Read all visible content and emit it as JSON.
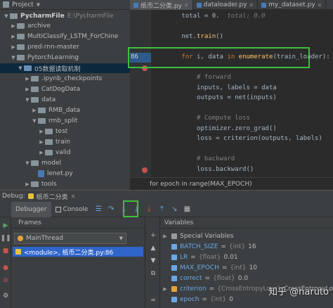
{
  "project": {
    "header_label": "Project",
    "root_name": "PycharmFile",
    "root_path": "E:\\PycharmFile",
    "tree": [
      {
        "label": "archive",
        "indent": 1,
        "open": false,
        "kind": "folder"
      },
      {
        "label": "MultiClassify_LSTM_ForChine",
        "indent": 1,
        "open": false,
        "kind": "folder"
      },
      {
        "label": "pred-rnn-master",
        "indent": 1,
        "open": false,
        "kind": "folder"
      },
      {
        "label": "PytorchLearning",
        "indent": 1,
        "open": true,
        "kind": "folder"
      },
      {
        "label": "05数据读取机制",
        "indent": 2,
        "open": true,
        "kind": "folder-blue",
        "selected": true
      },
      {
        "label": ".ipynb_checkpoints",
        "indent": 3,
        "open": false,
        "kind": "folder"
      },
      {
        "label": "CatDogData",
        "indent": 3,
        "open": false,
        "kind": "folder"
      },
      {
        "label": "data",
        "indent": 3,
        "open": true,
        "kind": "folder"
      },
      {
        "label": "RMB_data",
        "indent": 4,
        "open": false,
        "kind": "folder"
      },
      {
        "label": "rmb_split",
        "indent": 4,
        "open": true,
        "kind": "folder"
      },
      {
        "label": "test",
        "indent": 5,
        "open": false,
        "kind": "folder"
      },
      {
        "label": "train",
        "indent": 5,
        "open": false,
        "kind": "folder"
      },
      {
        "label": "valid",
        "indent": 5,
        "open": false,
        "kind": "folder"
      },
      {
        "label": "model",
        "indent": 3,
        "open": true,
        "kind": "folder"
      },
      {
        "label": "lenet.py",
        "indent": 4,
        "open": null,
        "kind": "py"
      },
      {
        "label": "tools",
        "indent": 3,
        "open": false,
        "kind": "folder"
      }
    ]
  },
  "tabs": [
    {
      "label": "纸币二分类.py",
      "active": true
    },
    {
      "label": "dataloader.py",
      "active": false
    },
    {
      "label": "my_dataset.py",
      "active": false
    }
  ],
  "editor": {
    "exec_line_number": "86",
    "breakpoints_at_rows": [
      5,
      15
    ],
    "lines": [
      {
        "tokens": [
          {
            "t": "        total = 0.  ",
            "c": ""
          },
          {
            "t": "total: 0.0",
            "c": "hint"
          }
        ]
      },
      {
        "tokens": [
          {
            "t": "",
            "c": ""
          }
        ]
      },
      {
        "tokens": [
          {
            "t": "        net.",
            "c": ""
          },
          {
            "t": "train",
            "c": "fn"
          },
          {
            "t": "()",
            "c": ""
          }
        ]
      },
      {
        "tokens": [
          {
            "t": "",
            "c": ""
          }
        ]
      },
      {
        "tokens": [
          {
            "t": "        ",
            "c": ""
          },
          {
            "t": "for",
            "c": "kw"
          },
          {
            "t": " i, data ",
            "c": ""
          },
          {
            "t": "in",
            "c": "kw"
          },
          {
            "t": " ",
            "c": ""
          },
          {
            "t": "enumerate",
            "c": "fn"
          },
          {
            "t": "(train_loader):",
            "c": ""
          }
        ]
      },
      {
        "tokens": [
          {
            "t": "",
            "c": ""
          }
        ]
      },
      {
        "tokens": [
          {
            "t": "            ",
            "c": ""
          },
          {
            "t": "# forward",
            "c": "cmt"
          }
        ]
      },
      {
        "tokens": [
          {
            "t": "            inputs, labels = data",
            "c": ""
          }
        ]
      },
      {
        "tokens": [
          {
            "t": "            outputs = net(inputs)",
            "c": ""
          }
        ]
      },
      {
        "tokens": [
          {
            "t": "",
            "c": ""
          }
        ]
      },
      {
        "tokens": [
          {
            "t": "            ",
            "c": ""
          },
          {
            "t": "# Compute loss",
            "c": "cmt"
          }
        ]
      },
      {
        "tokens": [
          {
            "t": "            optimizer.zero_grad()",
            "c": ""
          }
        ]
      },
      {
        "tokens": [
          {
            "t": "            loss = criterion(outputs, labels)",
            "c": ""
          }
        ]
      },
      {
        "tokens": [
          {
            "t": "",
            "c": ""
          }
        ]
      },
      {
        "tokens": [
          {
            "t": "            ",
            "c": ""
          },
          {
            "t": "# backward",
            "c": "cmt"
          }
        ]
      },
      {
        "tokens": [
          {
            "t": "            loss.backward()",
            "c": ""
          }
        ]
      }
    ],
    "breadcrumb": "for epoch in range(MAX_EPOCH)"
  },
  "debug": {
    "label": "Debug:",
    "config_name": "纸币二分类",
    "tabs": [
      {
        "label": "Debugger",
        "active": true
      },
      {
        "label": "Console",
        "active": false
      }
    ],
    "frames_title": "Frames",
    "thread": "MainThread",
    "frame": "<module>, 纸币二分类.py:86",
    "variables_title": "Variables",
    "variables": [
      {
        "name": "Special Variables",
        "type": "",
        "value": "",
        "icon": "list",
        "expandable": true
      },
      {
        "name": "BATCH_SIZE",
        "type": "{int}",
        "value": "16",
        "icon": "var",
        "expandable": false
      },
      {
        "name": "LR",
        "type": "{float}",
        "value": "0.01",
        "icon": "var",
        "expandable": false
      },
      {
        "name": "MAX_EPOCH",
        "type": "{int}",
        "value": "10",
        "icon": "var",
        "expandable": false
      },
      {
        "name": "correct",
        "type": "{float}",
        "value": "0.0",
        "icon": "var",
        "expandable": false
      },
      {
        "name": "criterion",
        "type": "{CrossEntropyLoss}",
        "value": "CrossEntropyLoss()",
        "icon": "obj",
        "expandable": true
      },
      {
        "name": "epoch",
        "type": "{int}",
        "value": "0",
        "icon": "var",
        "expandable": false
      }
    ]
  },
  "watermark": "知乎 @naruto"
}
